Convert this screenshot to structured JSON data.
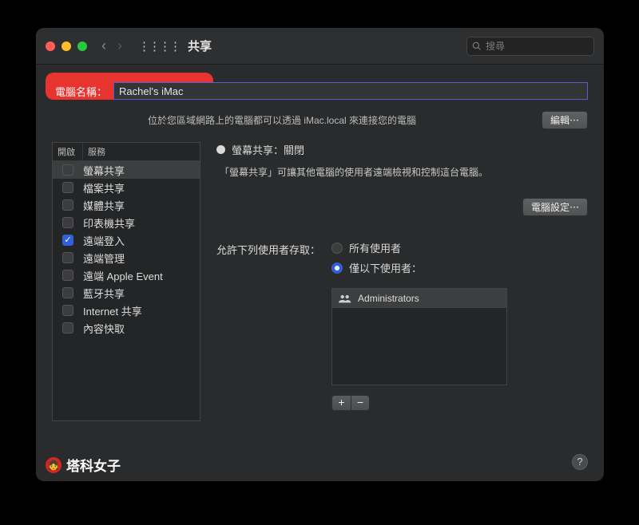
{
  "titlebar": {
    "title": "共享",
    "search_placeholder": "搜尋"
  },
  "computer_name": {
    "label": "電腦名稱：",
    "value": "Rachel's iMac",
    "subtext": "位於您區域網路上的電腦都可以透過 iMac.local 來連接您的電腦",
    "edit_button": "編輯⋯"
  },
  "services": {
    "header_on": "開啟",
    "header_service": "服務",
    "items": [
      {
        "label": "螢幕共享",
        "checked": false,
        "selected": true
      },
      {
        "label": "檔案共享",
        "checked": false,
        "selected": false
      },
      {
        "label": "媒體共享",
        "checked": false,
        "selected": false
      },
      {
        "label": "印表機共享",
        "checked": false,
        "selected": false
      },
      {
        "label": "遠端登入",
        "checked": true,
        "selected": false
      },
      {
        "label": "遠端管理",
        "checked": false,
        "selected": false
      },
      {
        "label": "遠端 Apple Event",
        "checked": false,
        "selected": false
      },
      {
        "label": "藍牙共享",
        "checked": false,
        "selected": false
      },
      {
        "label": "Internet 共享",
        "checked": false,
        "selected": false
      },
      {
        "label": "內容快取",
        "checked": false,
        "selected": false
      }
    ]
  },
  "detail": {
    "status": "螢幕共享：關閉",
    "description": "「螢幕共享」可讓其他電腦的使用者遠端檢視和控制這台電腦。",
    "computer_settings_button": "電腦設定⋯",
    "access_label": "允許下列使用者存取：",
    "option_all": "所有使用者",
    "option_only": "僅以下使用者：",
    "users": [
      "Administrators"
    ]
  },
  "watermark": "塔科女子"
}
